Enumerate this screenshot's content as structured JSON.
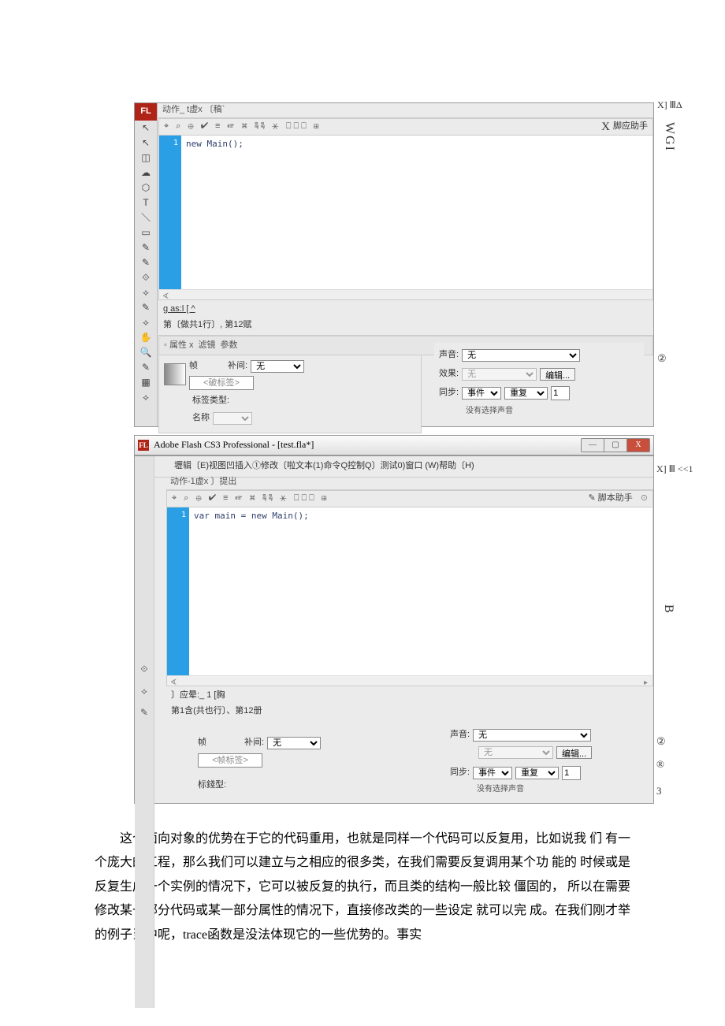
{
  "fig1": {
    "right_annot_top": "X] ⅢΔ",
    "right_annot_vert": "WGI",
    "right_annot_circ": "②",
    "tools": [
      "↖",
      "↖",
      "◫",
      "☁",
      "⬡",
      "T",
      "＼",
      "▭",
      "✎",
      "✎",
      "⟐",
      "⟡",
      "✎",
      "⟡",
      "✋",
      "🔍",
      "✎",
      "▦",
      "⟡"
    ],
    "tabbar": "动作_ t虚x 〔稿`",
    "tb_icons": "⌖ ⌕ ⊕ ✔ ≡  ☞ ⌘  ☟☟ ⚹  ⎕⎕⎕  ⊞",
    "script_assist": "脚应助手",
    "gutter": "1",
    "code": "new Main();",
    "below_code_link": "g as:l [ ^",
    "below_code_line": "第〔做共1行〕, 第12赋",
    "prop_tabs": [
      "◦ 属性 x",
      "滤镜",
      "参数"
    ],
    "frame_lbl": "帧",
    "tween_lbl": "补间:",
    "tween_val": "无",
    "tag_placeholder": "<破标签>",
    "label_type": "标签类型:",
    "name_lbl": "名称",
    "sound_lbl": "声音:",
    "sound_val": "无",
    "effect_lbl": "效果:",
    "effect_val": "无",
    "edit_btn": "编辑...",
    "sync_lbl": "同步:",
    "sync_val": "事件",
    "repeat_val": "重复",
    "repeat_num": "1",
    "no_sound": "没有选择声音"
  },
  "fig2": {
    "title": "Adobe Flash CS3 Professional - [test.fla*]",
    "menu": "壢辑〔E)视图凹插入①修改〔啦文本(1)命令Q控制Q〕测试0)窗口 (W)帮助〔H)",
    "right_top": "X] Ⅲ <<1",
    "tabbar": "动作-1虚x 〕提出",
    "tb_icons": "⌖ ⌕ ⊕ ✔ ≡  ☞ ⌘  ☟☟ ⚹  ⎕⎕⎕  ⊞",
    "script_assist": "✎ 脚本助手",
    "help_btn": "⊙",
    "gutter": "1",
    "code": "var main = new Main();",
    "layer_line": "〕应晕:_ 1 [胸",
    "line_info": "第1含(共也行〕、第12册",
    "tool_icons": [
      "⟐",
      "⟡",
      "✎"
    ],
    "frame_lbl": "帧",
    "tween_lbl": "补间:",
    "tween_val": "无",
    "tag_placeholder": "<帧标签>",
    "label_type": "标錢型:",
    "sound_lbl": "声音:",
    "sound_val": "无",
    "effect_val": "无",
    "edit_btn": "编辑...",
    "sync_lbl": "同步:",
    "sync_val": "事件",
    "repeat_val": "重复",
    "repeat_num": "1",
    "no_sound": "没有选择声音",
    "right_sym1": "②",
    "right_sym2": "®",
    "right_sym3": "3",
    "right_vert": "B"
  },
  "paragraph": "这个面向对象的优势在于它的代码重用，也就是同样一个代码可以反复用，比如说我 们   有一个庞大的工程，那么我们可以建立与之相应的很多类，在我们需要反复调用某个功 能的   时候或是反复生成一个实例的情况下，它可以被反复的执行，而且类的结构一般比较 僵固的，   所以在需要修改某一部分代码或某一部分属性的情况下，直接修改类的一些设定 就可以完   成。在我们刚才举的例子当中呢，trace函数是没法体现它的一些优势的。事实"
}
